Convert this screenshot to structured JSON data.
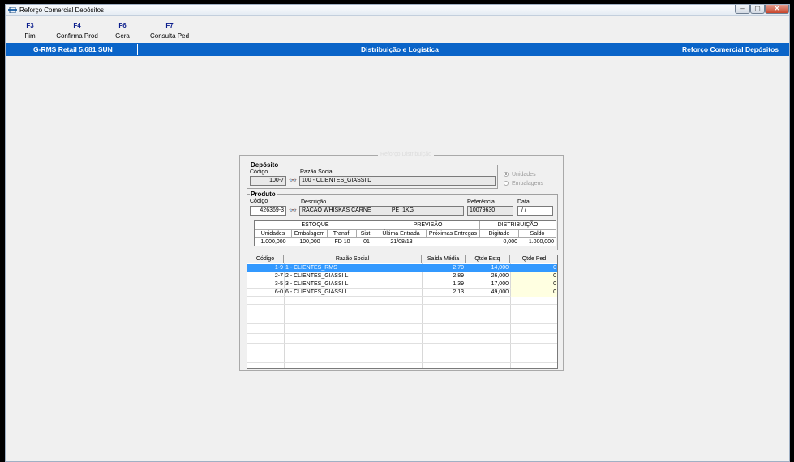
{
  "window": {
    "title": "Reforço Comercial Depósitos",
    "min": "–",
    "max": "▢",
    "close": "✕"
  },
  "toolbar": [
    {
      "key": "F3",
      "label": "Fim"
    },
    {
      "key": "F4",
      "label": "Confirma Prod"
    },
    {
      "key": "F6",
      "label": "Gera"
    },
    {
      "key": "F7",
      "label": "Consulta Ped"
    }
  ],
  "statusbar": {
    "left": "G-RMS Retail 5.681 SUN",
    "center": "Distribuição e Logística",
    "right": "Reforço Comercial Depósitos"
  },
  "dialog": {
    "title": "Reforço Distribuição",
    "deposito": {
      "group": "Depósito",
      "codigo_label": "Código",
      "razao_label": "Razão Social",
      "codigo": "100-7",
      "razao": "100 - CLIENTES_GIASSI D",
      "radio_unidades": "Unidades",
      "radio_embalagens": "Embalagens"
    },
    "produto": {
      "group": "Produto",
      "codigo_label": "Código",
      "descricao_label": "Descrição",
      "referencia_label": "Referência",
      "data_label": "Data",
      "codigo": "426369-3",
      "descricao": "RACAO WHISKAS CARNE             PE  1KG",
      "referencia": "10079630",
      "data": " / /"
    },
    "stock": {
      "estoque": "ESTOQUE",
      "previsao": "PREVISÃO",
      "distribuicao": "DISTRIBUIÇÃO",
      "cols": [
        "Unidades",
        "Embalagem",
        "Transf.",
        "Sist.",
        "Última Entrada",
        "Próximas Entregas",
        "Digitado",
        "Saldo"
      ],
      "vals": [
        "1.000,000",
        "100,000",
        "FD 10",
        "01",
        "21/08/13",
        "",
        "0,000",
        "1.000,000"
      ]
    },
    "grid": {
      "headers": [
        "Código",
        "Razão Social",
        "Saída Média",
        "Qtde Estq",
        "Qtde Ped"
      ],
      "rows": [
        {
          "codigo": "1-9",
          "razao": "1 - CLIENTES_RMS",
          "saida": "2,70",
          "estq": "14,000",
          "ped": "0"
        },
        {
          "codigo": "2-7",
          "razao": "2 - CLIENTES_GIASSI L",
          "saida": "2,89",
          "estq": "26,000",
          "ped": "0"
        },
        {
          "codigo": "3-5",
          "razao": "3 - CLIENTES_GIASSI L",
          "saida": "1,39",
          "estq": "17,000",
          "ped": "0"
        },
        {
          "codigo": "6-0",
          "razao": "6 - CLIENTES_GIASSI L",
          "saida": "2,13",
          "estq": "49,000",
          "ped": "0"
        }
      ]
    }
  }
}
